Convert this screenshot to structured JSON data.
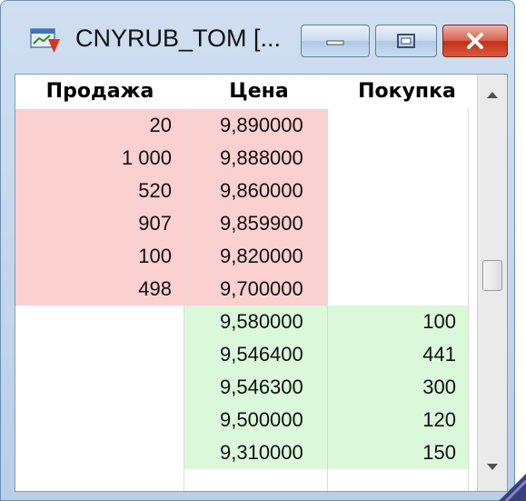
{
  "window": {
    "title": "CNYRUB_TOM [...",
    "icon": "chart-down-icon"
  },
  "header": {
    "sell": "Продажа",
    "price": "Цена",
    "buy": "Покупка"
  },
  "rows": [
    {
      "sell": "20",
      "price": "9,890000",
      "buy": "",
      "side": "ask"
    },
    {
      "sell": "1 000",
      "price": "9,888000",
      "buy": "",
      "side": "ask"
    },
    {
      "sell": "520",
      "price": "9,860000",
      "buy": "",
      "side": "ask"
    },
    {
      "sell": "907",
      "price": "9,859900",
      "buy": "",
      "side": "ask"
    },
    {
      "sell": "100",
      "price": "9,820000",
      "buy": "",
      "side": "ask"
    },
    {
      "sell": "498",
      "price": "9,700000",
      "buy": "",
      "side": "ask"
    },
    {
      "sell": "",
      "price": "9,580000",
      "buy": "100",
      "side": "bid"
    },
    {
      "sell": "",
      "price": "9,546400",
      "buy": "441",
      "side": "bid"
    },
    {
      "sell": "",
      "price": "9,546300",
      "buy": "300",
      "side": "bid"
    },
    {
      "sell": "",
      "price": "9,500000",
      "buy": "120",
      "side": "bid"
    },
    {
      "sell": "",
      "price": "9,310000",
      "buy": "150",
      "side": "bid"
    }
  ],
  "colors": {
    "ask": "#fbd0d0",
    "bid": "#dbf8db",
    "close_button": "#c2301b",
    "title_bar": "#cfdff0"
  }
}
